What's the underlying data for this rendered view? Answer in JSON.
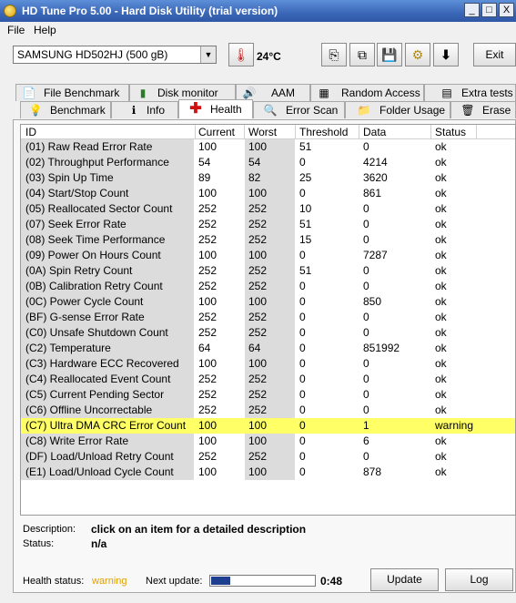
{
  "app": {
    "title": "HD Tune Pro 5.00 - Hard Disk Utility (trial version)",
    "window_controls": {
      "minimize": "_",
      "maximize": "□",
      "close": "X"
    }
  },
  "menu": {
    "file": "File",
    "help": "Help"
  },
  "toolbar": {
    "drive": "SAMSUNG HD502HJ (500 gB)",
    "temperature": "24°C",
    "exit_label": "Exit",
    "icons": [
      "thermometer-icon",
      "copy-icon",
      "copy-all-icon",
      "save-icon",
      "settings-icon",
      "down-arrow-icon"
    ]
  },
  "tabs_row1": [
    {
      "label": "File Benchmark",
      "icon": "file-benchmark-icon"
    },
    {
      "label": "Disk monitor",
      "icon": "disk-monitor-icon"
    },
    {
      "label": "AAM",
      "icon": "speaker-icon"
    },
    {
      "label": "Random Access",
      "icon": "random-access-icon"
    },
    {
      "label": "Extra tests",
      "icon": "extra-tests-icon"
    }
  ],
  "tabs_row2": [
    {
      "label": "Benchmark",
      "icon": "lightbulb-icon"
    },
    {
      "label": "Info",
      "icon": "info-icon"
    },
    {
      "label": "Health",
      "icon": "health-cross-icon",
      "active": true
    },
    {
      "label": "Error Scan",
      "icon": "magnifier-icon"
    },
    {
      "label": "Folder Usage",
      "icon": "folder-icon"
    },
    {
      "label": "Erase",
      "icon": "trash-icon"
    }
  ],
  "table": {
    "columns": [
      "ID",
      "Current",
      "Worst",
      "Threshold",
      "Data",
      "Status"
    ],
    "rows": [
      [
        "(01) Raw Read Error Rate",
        "100",
        "100",
        "51",
        "0",
        "ok"
      ],
      [
        "(02) Throughput Performance",
        "54",
        "54",
        "0",
        "4214",
        "ok"
      ],
      [
        "(03) Spin Up Time",
        "89",
        "82",
        "25",
        "3620",
        "ok"
      ],
      [
        "(04) Start/Stop Count",
        "100",
        "100",
        "0",
        "861",
        "ok"
      ],
      [
        "(05) Reallocated Sector Count",
        "252",
        "252",
        "10",
        "0",
        "ok"
      ],
      [
        "(07) Seek Error Rate",
        "252",
        "252",
        "51",
        "0",
        "ok"
      ],
      [
        "(08) Seek Time Performance",
        "252",
        "252",
        "15",
        "0",
        "ok"
      ],
      [
        "(09) Power On Hours Count",
        "100",
        "100",
        "0",
        "7287",
        "ok"
      ],
      [
        "(0A) Spin Retry Count",
        "252",
        "252",
        "51",
        "0",
        "ok"
      ],
      [
        "(0B) Calibration Retry Count",
        "252",
        "252",
        "0",
        "0",
        "ok"
      ],
      [
        "(0C) Power Cycle Count",
        "100",
        "100",
        "0",
        "850",
        "ok"
      ],
      [
        "(BF) G-sense Error Rate",
        "252",
        "252",
        "0",
        "0",
        "ok"
      ],
      [
        "(C0) Unsafe Shutdown Count",
        "252",
        "252",
        "0",
        "0",
        "ok"
      ],
      [
        "(C2) Temperature",
        "64",
        "64",
        "0",
        "851992",
        "ok"
      ],
      [
        "(C3) Hardware ECC Recovered",
        "100",
        "100",
        "0",
        "0",
        "ok"
      ],
      [
        "(C4) Reallocated Event Count",
        "252",
        "252",
        "0",
        "0",
        "ok"
      ],
      [
        "(C5) Current Pending Sector",
        "252",
        "252",
        "0",
        "0",
        "ok"
      ],
      [
        "(C6) Offline Uncorrectable",
        "252",
        "252",
        "0",
        "0",
        "ok"
      ],
      [
        "(C7) Ultra DMA CRC Error Count",
        "100",
        "100",
        "0",
        "1",
        "warning"
      ],
      [
        "(C8) Write Error Rate",
        "100",
        "100",
        "0",
        "6",
        "ok"
      ],
      [
        "(DF) Load/Unload Retry Count",
        "252",
        "252",
        "0",
        "0",
        "ok"
      ],
      [
        "(E1) Load/Unload Cycle Count",
        "100",
        "100",
        "0",
        "878",
        "ok"
      ]
    ],
    "warning_highlight": "#ffff66"
  },
  "description": {
    "description_label": "Description:",
    "description_value": "click on an item for a detailed description",
    "status_label": "Status:",
    "status_value": "n/a"
  },
  "statusbar": {
    "health_label": "Health status:",
    "health_value": "warning",
    "health_color": "#e0a000",
    "next_update_label": "Next update:",
    "progress_fraction": 0.19,
    "countdown": "0:48",
    "update_label": "Update",
    "log_label": "Log"
  }
}
